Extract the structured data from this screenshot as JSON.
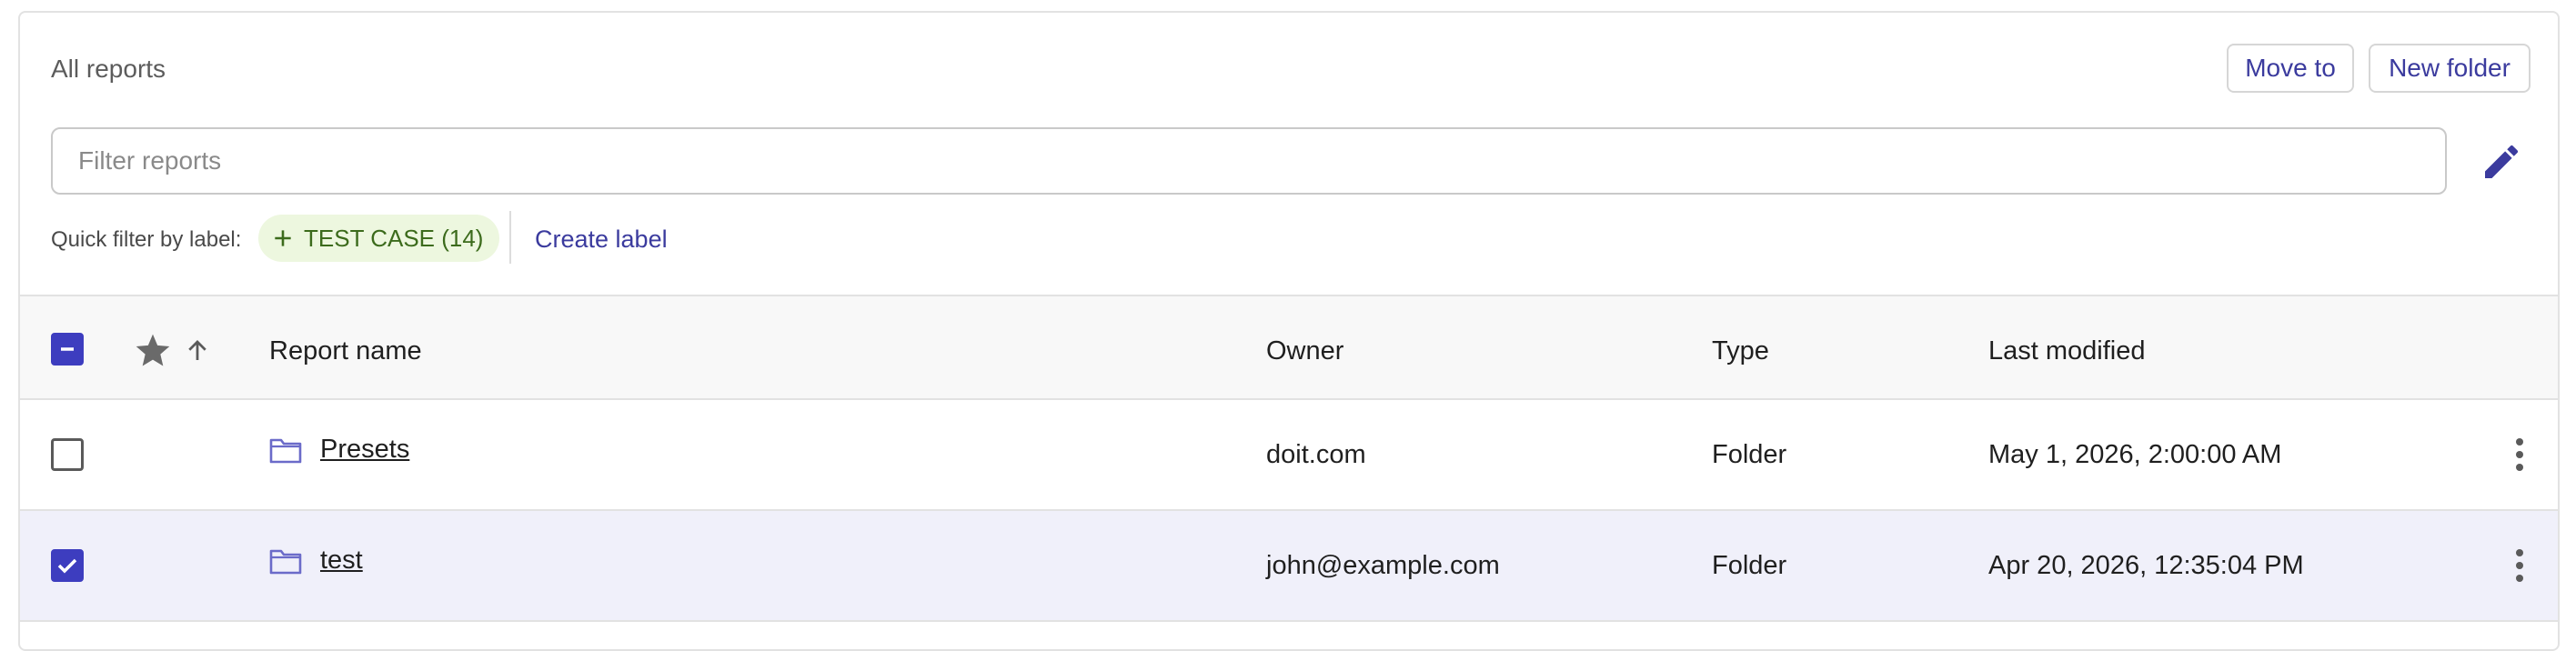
{
  "header": {
    "title": "All reports",
    "move_to_label": "Move to",
    "new_folder_label": "New folder"
  },
  "filter": {
    "placeholder": "Filter reports",
    "value": ""
  },
  "quick_filter": {
    "label": "Quick filter by label:",
    "chip_label": "TEST CASE (14)",
    "create_label": "Create label"
  },
  "table": {
    "columns": {
      "name": "Report name",
      "owner": "Owner",
      "type": "Type",
      "last_modified": "Last modified"
    },
    "rows": [
      {
        "name": "Presets",
        "owner": "doit.com",
        "type": "Folder",
        "last_modified": "May 1, 2026, 2:00:00 AM",
        "selected": false
      },
      {
        "name": "test",
        "owner": "john@example.com",
        "type": "Folder",
        "last_modified": "Apr 20, 2026, 12:35:04 PM",
        "selected": true
      }
    ]
  },
  "colors": {
    "accent": "#3d3dbf",
    "link": "#3b3b9e",
    "chip_bg": "#edf7df",
    "chip_text": "#3c6b1c",
    "selected_row_bg": "#f0f0fa",
    "header_bg": "#f8f8f8"
  },
  "icons": {
    "edit": "pencil-icon",
    "chip_add": "plus-icon",
    "header_checkbox": "indeterminate-checkbox-icon",
    "favorite": "star-icon",
    "sort": "arrow-up-icon",
    "row_type": "folder-icon",
    "row_menu": "more-vertical-icon"
  }
}
